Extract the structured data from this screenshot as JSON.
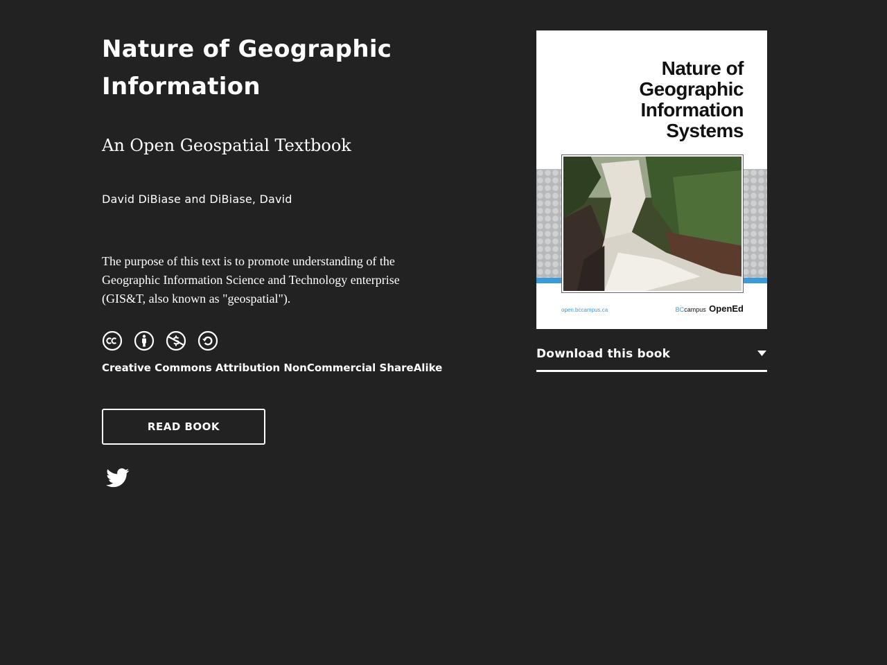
{
  "book": {
    "title": "Nature of Geographic Information",
    "subtitle": "An Open Geospatial Textbook",
    "authors": "David DiBiase and DiBiase, David",
    "description": "The purpose of this text is to promote understanding of the Geographic Information Science and Technology enterprise (GIS&T, also known as \"geospatial\")."
  },
  "license": {
    "icons": [
      "cc-icon",
      "attribution-icon",
      "noncommercial-icon",
      "sharealike-icon"
    ],
    "label": "Creative Commons Attribution NonCommercial ShareAlike"
  },
  "actions": {
    "read_label": "READ BOOK",
    "share_icon": "twitter-icon",
    "download_label": "Download this book"
  },
  "cover": {
    "title_lines": [
      "Nature of",
      "Geographic",
      "Information",
      "Systems"
    ],
    "url": "open.bccampus.ca",
    "publisher_bc": "BC",
    "publisher_campus": "campus",
    "publisher_opened": "OpenEd",
    "colors": {
      "accent": "#3b9ad9",
      "band": "#b7b8ba"
    }
  },
  "colors": {
    "background": "#222222",
    "text": "#ffffff"
  }
}
